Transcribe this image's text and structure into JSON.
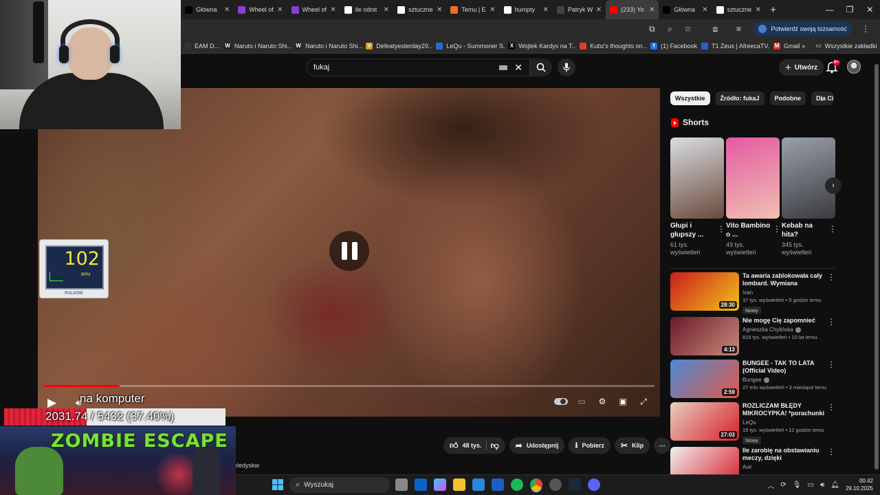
{
  "browser": {
    "tabs": [
      {
        "label": "Główna",
        "icon": "x-logo-icon",
        "color": "#000000"
      },
      {
        "label": "Wheel of",
        "icon": "wheel-icon",
        "color": "#8b3fd1"
      },
      {
        "label": "Wheel of",
        "icon": "wheel-icon",
        "color": "#8b3fd1"
      },
      {
        "label": "ile odrst",
        "icon": "google-icon",
        "color": "#ffffff"
      },
      {
        "label": "sztuczne",
        "icon": "google-icon",
        "color": "#ffffff"
      },
      {
        "label": "Temu | E",
        "icon": "temu-icon",
        "color": "#f26d21"
      },
      {
        "label": "humpty",
        "icon": "google-icon",
        "color": "#ffffff"
      },
      {
        "label": "Patryk W",
        "icon": "page-icon",
        "color": "#444444"
      },
      {
        "label": "(233) Yo",
        "icon": "youtube-icon",
        "color": "#ff0000"
      },
      {
        "label": "Główna",
        "icon": "x-logo-icon",
        "color": "#000000"
      },
      {
        "label": "sztuczne",
        "icon": "google-icon",
        "color": "#ffffff"
      }
    ],
    "verify_label": "Potwierdź swoją tożsamość",
    "bookmarks": [
      {
        "label": "EAM D...",
        "color": "#333333"
      },
      {
        "label": "Naruto i Naruto Shi...",
        "color": "#222222",
        "glyph": "W"
      },
      {
        "label": "Naruto i Naruto Shi...",
        "color": "#222222",
        "glyph": "W"
      },
      {
        "label": "Defeatyesterday29...",
        "color": "#d1a21a",
        "glyph": "V"
      },
      {
        "label": "LeQu - Summoner S...",
        "color": "#2b6cd4"
      },
      {
        "label": "Wojtek Kardys na T...",
        "color": "#000000",
        "glyph": "X"
      },
      {
        "label": "Kubz's thoughts on...",
        "color": "#e0402a"
      },
      {
        "label": "(1) Facebook",
        "color": "#1877f2",
        "glyph": "f"
      },
      {
        "label": "T1 Zeus | AfreecaTV...",
        "color": "#2a5fd6"
      },
      {
        "label": "Gmail",
        "color": "#d93025",
        "glyph": "M"
      }
    ],
    "all_bookmarks_label": "Wszystkie zakładki"
  },
  "youtube": {
    "search_value": "fukaj",
    "create_label": "Utwórz",
    "notification_count": "9+",
    "chips": [
      "Wszystkie",
      "Źródło: fukaJ",
      "Podobne",
      "Dla Ci"
    ],
    "shorts_heading": "Shorts",
    "shorts": [
      {
        "title": "Głupi i głupszy ...",
        "views": "61 tys. wyświetleń",
        "color_a": "#d9dde4",
        "color_b": "#6b4a3a"
      },
      {
        "title": "Vito Bambino o ...",
        "views": "49 tys. wyświetleń",
        "color_a": "#e45aa4",
        "color_b": "#f0c0b0"
      },
      {
        "title": "Kebab na hita?",
        "views": "345 tys. wyświetleń",
        "color_a": "#9aa0a8",
        "color_b": "#3a3a40"
      }
    ],
    "videos": [
      {
        "title": "Ta awaria zablokowała cały lombard. Wymiana oświetlenia...",
        "channel": "Ivan",
        "verified": false,
        "views": "37 tys. wyświetleń",
        "age": "5 godzin temu",
        "badge": "Nowy",
        "duration": "28:30",
        "color_a": "#c91c1c",
        "color_b": "#f4c21a"
      },
      {
        "title": "Nie mogę Cię zapomnieć",
        "channel": "Agnieszka Chylińska",
        "verified": true,
        "views": "816 tys. wyświetleń",
        "age": "10 lat temu",
        "badge": "",
        "duration": "4:13",
        "color_a": "#6a1a2a",
        "color_b": "#c88a7a"
      },
      {
        "title": "BUNGEE - TAK TO LATA (Official Video)",
        "channel": "Bungee",
        "verified": true,
        "views": "27 mln wyświetleń",
        "age": "3 miesiące temu",
        "badge": "",
        "duration": "2:59",
        "color_a": "#4a8ad4",
        "color_b": "#e05a4a"
      },
      {
        "title": "ROZLICZAM BŁĘDY MIKROCYPKA! *porachunki z ...",
        "channel": "LeQu",
        "verified": false,
        "views": "19 tys. wyświetleń",
        "age": "12 godzin temu",
        "badge": "Nowy",
        "duration": "27:03",
        "color_a": "#e8d0c0",
        "color_b": "#d81e2a"
      },
      {
        "title": "Ile zarobię na obstawianiu meczy, dzięki TIKTOKOWEMU ...",
        "channel": "Avir",
        "verified": false,
        "views": "",
        "age": "",
        "badge": "",
        "duration": "",
        "color_a": "#f0f0f0",
        "color_b": "#d81e2a"
      }
    ],
    "actions": {
      "likes": "48 tys.",
      "share": "Udostępnij",
      "download": "Pobierz",
      "clip": "Klip"
    },
    "description_label": "eledyskw",
    "video_progress": 0.125
  },
  "overlay": {
    "bpm": "102",
    "bpm_unit": "BPM",
    "pulsoid_label": "PULSOID",
    "goal_title": "na komputer",
    "goal_value": "2031.74 / 5432 (37.40%)",
    "goal_fraction": 0.374,
    "game_title": "ZOMBIE ESCAPE"
  },
  "taskbar": {
    "search_label": "Wyszukaj",
    "time": "00:42",
    "date": "29.10.2025"
  }
}
